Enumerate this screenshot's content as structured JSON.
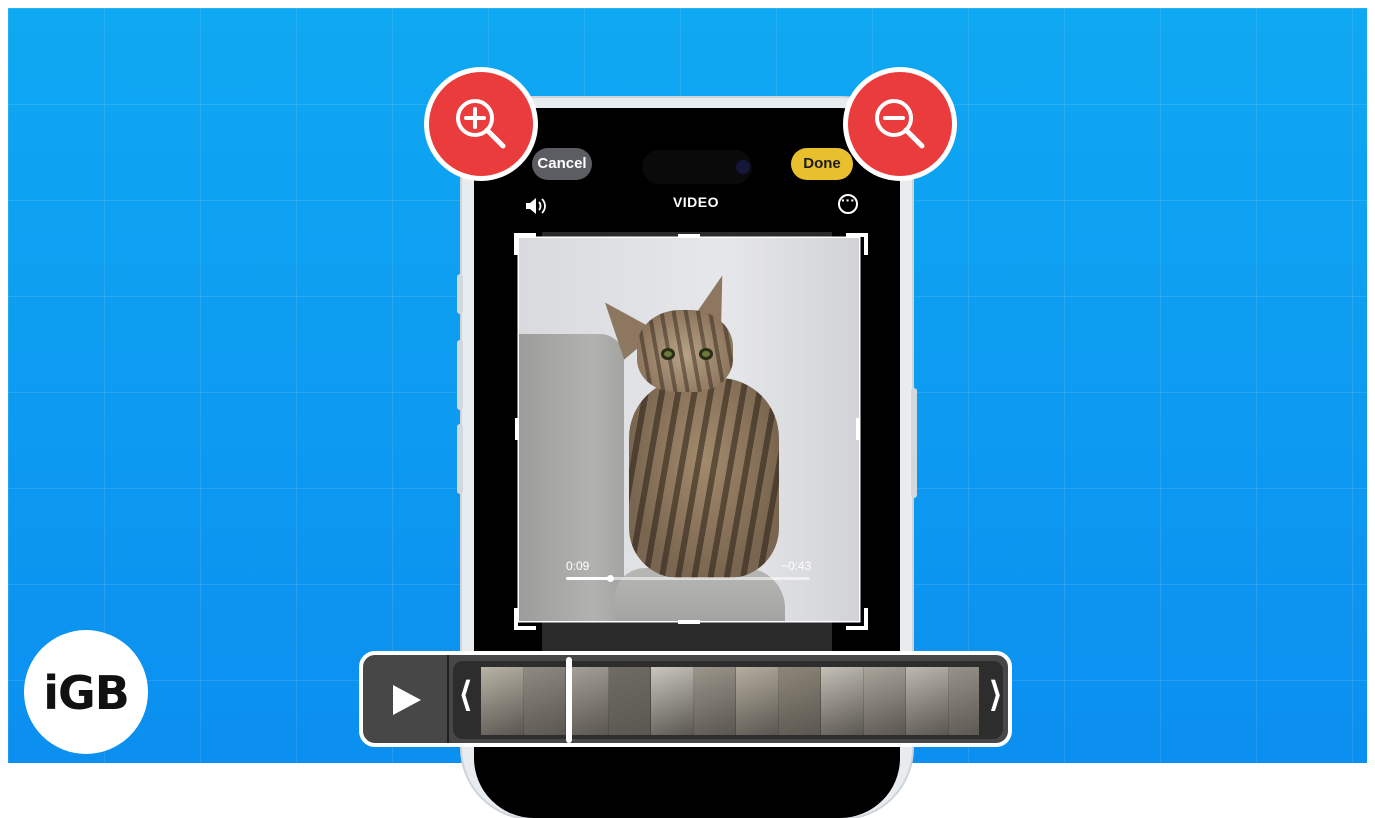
{
  "editor": {
    "cancel_label": "Cancel",
    "done_label": "Done",
    "mode_title": "VIDEO",
    "volume_icon": "speaker-icon",
    "more_icon": "ellipsis-circle-icon"
  },
  "player": {
    "elapsed": "0:09",
    "remaining": "−0:43",
    "progress_fraction": 0.18
  },
  "timeline": {
    "play_icon": "play-icon",
    "left_handle": "⟨",
    "right_handle": "⟩",
    "thumbnail_count": 12
  },
  "badges": {
    "zoom_in_icon": "zoom-in-icon",
    "zoom_out_icon": "zoom-out-icon",
    "accent_color": "#ea3b3d"
  },
  "brand": {
    "logo_text": "iGB"
  },
  "colors": {
    "background": "#0b9af1",
    "done_button": "#e8c02e",
    "cancel_button": "#5b5d62"
  }
}
